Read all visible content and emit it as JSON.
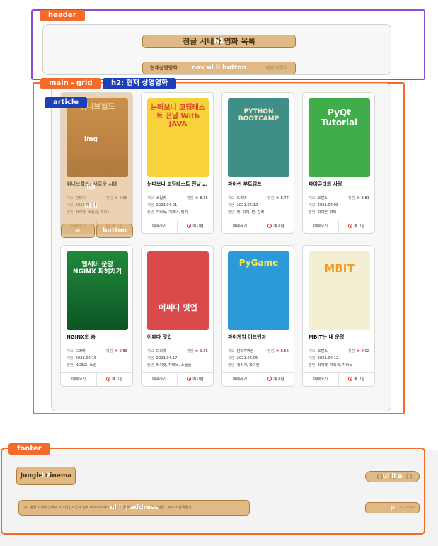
{
  "overlay_tags": {
    "header": "header",
    "main_grid": "main - grid",
    "h2": "h2: 현재 상영영화",
    "article": "article",
    "footer": "footer"
  },
  "header": {
    "title": "정글 시네마 영화 목록",
    "title_tag": "h1",
    "nav": {
      "current": "현재상영영화",
      "upcoming": "개봉예정작",
      "tag": "nav ul li button"
    }
  },
  "first_card_tags": {
    "img": "img",
    "h3": "h3",
    "ul_li": "ul li",
    "a": "a",
    "button": "button"
  },
  "labels": {
    "genre": "개요",
    "release": "개봉",
    "cast": "출연",
    "rating": "평점",
    "reserve": "예매하기",
    "trailer": "예고편"
  },
  "movies": [
    {
      "title": "위니브월드: 새로운 시대",
      "genre": "판타지",
      "date": "2021.05.11",
      "cast": "라이캣, 소울곰, 개리씨",
      "rating": "9.85",
      "cover_text": "위니브월드"
    },
    {
      "title": "눈떠보니 코딩테스트 전날 with JAVA",
      "genre": "스릴러",
      "date": "2021.04.01",
      "cast": "자바독, 개리씨, 빙키",
      "rating": "8.25",
      "cover_text": "눈떠보니 코딩테스트 전날 With JAVA"
    },
    {
      "title": "파이썬 부트캠프",
      "genre": "드라마",
      "date": "2021.04.12",
      "cast": "캣, 파이, 썬, 링리",
      "rating": "8.77",
      "cover_text": "PYTHON BOOTCAMP"
    },
    {
      "title": "파이큐티의 사랑",
      "genre": "로맨스",
      "date": "2021.04.08",
      "cast": "파이썬, 큐티",
      "rating": "8.81",
      "cover_text": "PyQt Tutorial"
    },
    {
      "title": "NGINX의 춤",
      "genre": "드라마",
      "date": "2021.04.15",
      "cast": "NGINX, 노션",
      "rating": "9.88",
      "cover_text": "웹서버 운영 NGINX 파헤치기"
    },
    {
      "title": "어쩌다 밋업",
      "genre": "드라마",
      "date": "2021.04.17",
      "cast": "라이캣, 자바독, 소울곰",
      "rating": "9.25",
      "cover_text": "어쩌다 밋업"
    },
    {
      "title": "파이게임 어드벤처",
      "genre": "판타지액션",
      "date": "2021.04.05",
      "cast": "개리씨, 파이썬",
      "rating": "8.56",
      "cover_text": "PyGame"
    },
    {
      "title": "MBIT는 내 운명",
      "genre": "로맨스",
      "date": "2021.04.12",
      "cast": "라이캣, 개리씨, 자바독",
      "rating": "9.02",
      "cover_text": "MBIT"
    }
  ],
  "footer": {
    "logo": "Jungle Cinema",
    "logo_tag": "h2",
    "social_tag": "ul li a",
    "address": "(주) 정글 시네마 | 대표 라이캣 | 사업자 번호 000-00-00000 | 통신판매업 및 비디오물 제작업 | 주소 서울특별시",
    "address_tag": "ul li / address",
    "copyright": "© Jungle",
    "copyright_tag": "p"
  },
  "colors": {
    "tag_orange": "#f36a2a",
    "tag_blue": "#1d3fb8",
    "header_outline": "#8a4dd8",
    "overlay_fill": "#e0b985",
    "star": "#e5322d"
  }
}
